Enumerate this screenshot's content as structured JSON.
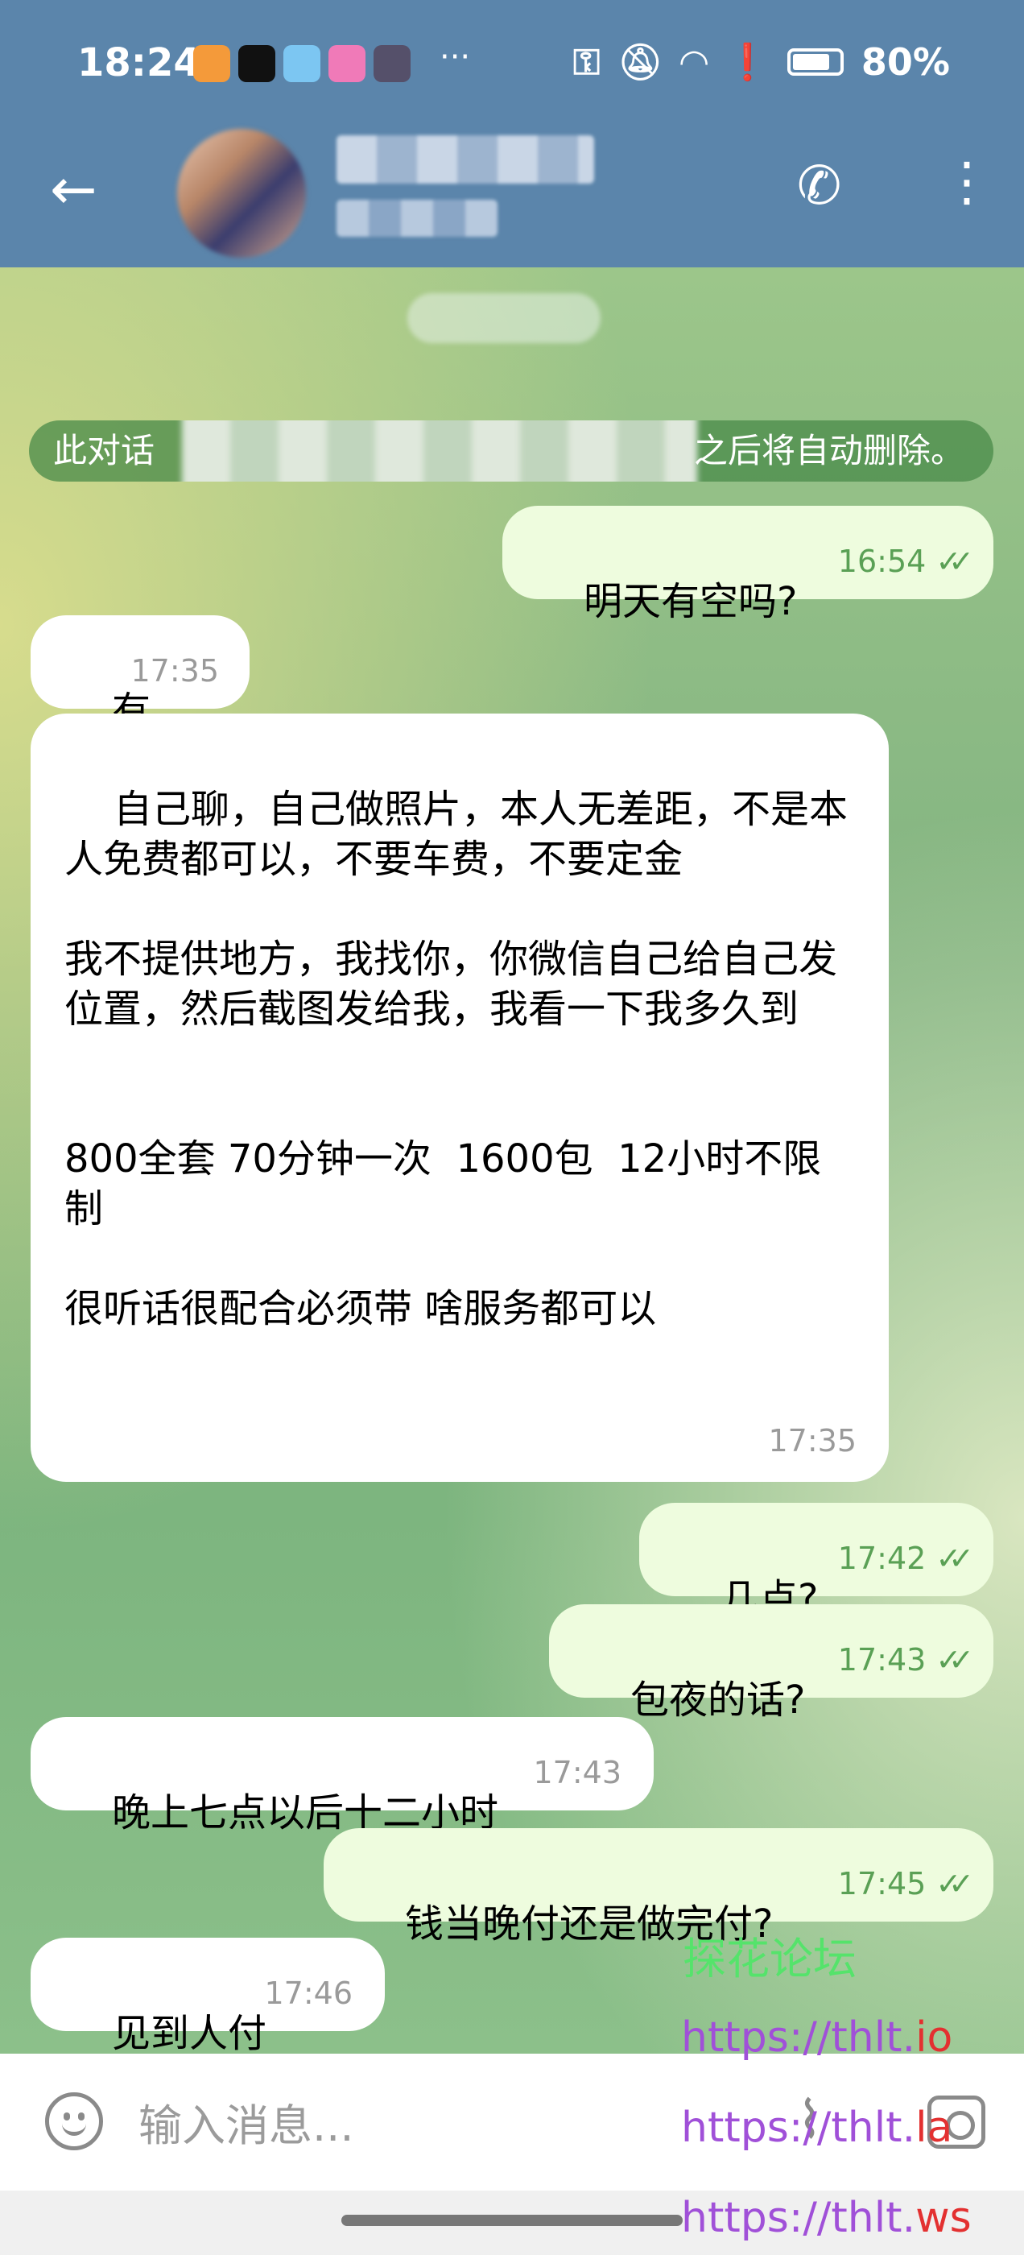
{
  "status_bar": {
    "time": "18:24",
    "battery": "80%",
    "battery_level": 0.8,
    "more": "···",
    "icons": [
      "key-icon",
      "mute-icon",
      "wifi-icon",
      "alert-icon",
      "battery-icon"
    ]
  },
  "header": {
    "back_icon": "←",
    "contact_name": "",
    "contact_status": "",
    "call_icon": "✆",
    "menu_icon": "⋮"
  },
  "chat": {
    "date_label": "",
    "service_message_prefix": "此对话",
    "service_message_suffix": "之后将自动删除。",
    "messages": [
      {
        "dir": "out",
        "text": "明天有空吗?",
        "time": "16:54",
        "read": true
      },
      {
        "dir": "in",
        "text": "有",
        "time": "17:35"
      },
      {
        "dir": "in",
        "text": "自己聊，自己做照片，本人无差距，不是本人免费都可以，不要车费，不要定金\n\n我不提供地方，我找你，你微信自己给自己发位置，然后截图发给我，我看一下我多久到\n\n\n800全套 70分钟一次  1600包  12小时不限制\n\n很听话很配合必须带 啥服务都可以",
        "time": "17:35"
      },
      {
        "dir": "out",
        "text": "几点?",
        "time": "17:42",
        "read": true
      },
      {
        "dir": "out",
        "text": "包夜的话?",
        "time": "17:43",
        "read": true
      },
      {
        "dir": "in",
        "text": "晚上七点以后十二小时",
        "time": "17:43"
      },
      {
        "dir": "out",
        "text": "钱当晚付还是做完付?",
        "time": "17:45",
        "read": true
      },
      {
        "dir": "in",
        "text": "见到人付",
        "time": "17:46"
      }
    ],
    "read_ticks": "✓✓"
  },
  "watermark": {
    "title": "探花论坛",
    "links": [
      {
        "base": "https://thlt.",
        "tld": "io"
      },
      {
        "base": "https://thlt.",
        "tld": "la"
      },
      {
        "base": "https://thlt.",
        "tld": "ws"
      }
    ]
  },
  "composer": {
    "placeholder": "输入消息...",
    "emoji_icon": "emoji-icon",
    "attach_icon": "paperclip-icon",
    "camera_icon": "camera-icon"
  },
  "colors": {
    "header": "#5b85ab",
    "outgoing_bubble": "#eefcde",
    "incoming_bubble": "#ffffff",
    "read_tick": "#5aa055",
    "watermark_green": "#55e36b",
    "watermark_purple": "#a050d8",
    "watermark_red": "#e33030"
  }
}
